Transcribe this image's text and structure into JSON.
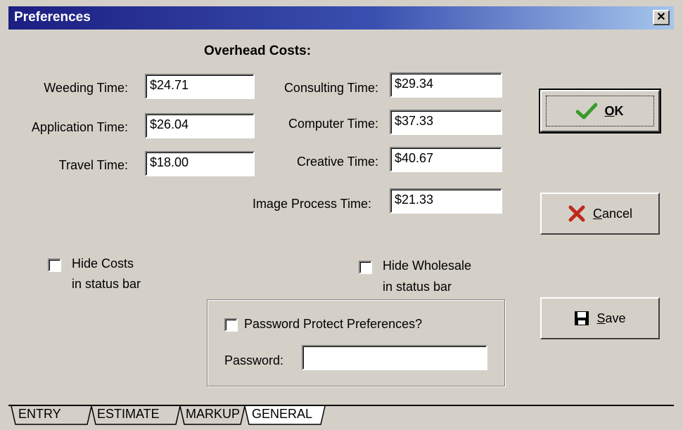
{
  "window": {
    "title": "Preferences",
    "close_glyph": "✕"
  },
  "overhead": {
    "heading": "Overhead Costs:",
    "fields": [
      {
        "label": "Weeding Time:",
        "value": "$24.71"
      },
      {
        "label": "Application Time:",
        "value": "$26.04"
      },
      {
        "label": "Travel Time:",
        "value": "$18.00"
      },
      {
        "label": "Consulting Time:",
        "value": "$29.34"
      },
      {
        "label": "Computer Time:",
        "value": "$37.33"
      },
      {
        "label": "Creative Time:",
        "value": "$40.67"
      },
      {
        "label": "Image Process Time:",
        "value": "$21.33"
      }
    ]
  },
  "checkboxes": {
    "hide_costs": {
      "line1": "Hide Costs",
      "line2": "in status bar",
      "checked": false
    },
    "hide_wholesale": {
      "line1": "Hide Wholesale",
      "line2": "in status bar",
      "checked": false
    }
  },
  "password_group": {
    "protect_label": "Password Protect Preferences?",
    "protect_checked": false,
    "password_label": "Password:",
    "password_value": ""
  },
  "buttons": {
    "ok": {
      "mnemonic": "O",
      "rest": "K",
      "icon": "check-icon"
    },
    "cancel": {
      "mnemonic": "C",
      "rest": "ancel",
      "icon": "x-icon"
    },
    "save": {
      "mnemonic": "S",
      "rest": "ave",
      "icon": "floppy-disk-icon"
    }
  },
  "tabs": [
    {
      "label": "ENTRY",
      "active": false
    },
    {
      "label": "ESTIMATE",
      "active": false
    },
    {
      "label": "MARKUP",
      "active": false
    },
    {
      "label": "GENERAL",
      "active": true
    }
  ],
  "colors": {
    "titlebar_start": "#1c1e82",
    "titlebar_end": "#a6c6ec",
    "check_green": "#3a9a2a",
    "cancel_red": "#c0281c"
  }
}
